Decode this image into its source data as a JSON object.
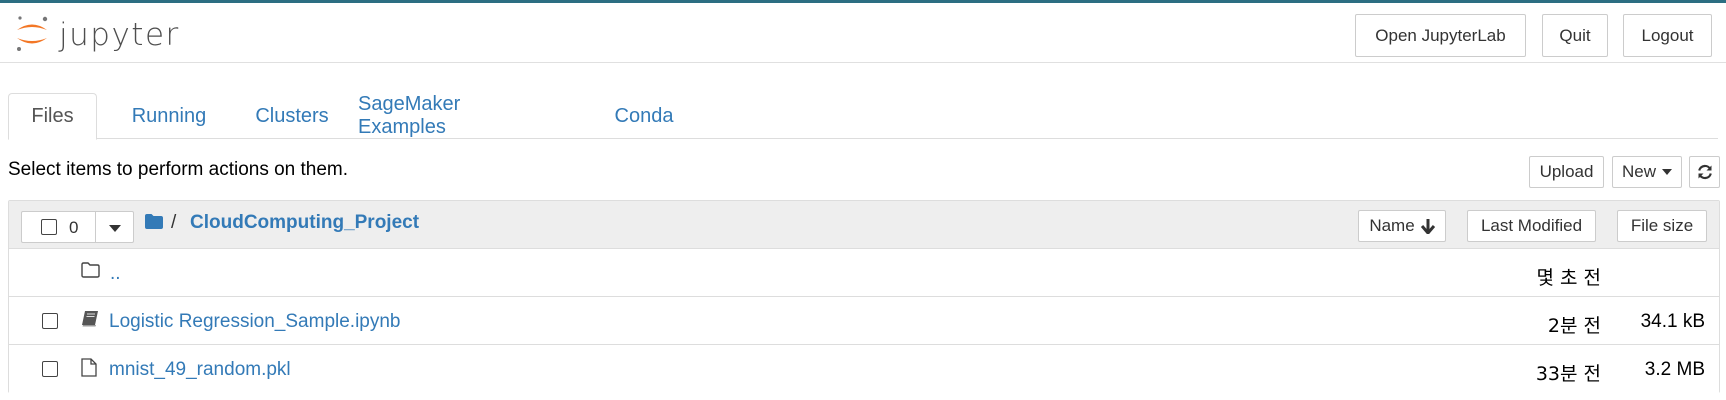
{
  "header": {
    "brand": "jupyter",
    "open_jupyterlab": "Open JupyterLab",
    "quit": "Quit",
    "logout": "Logout"
  },
  "tabs": [
    {
      "label": "Files",
      "active": true
    },
    {
      "label": "Running",
      "active": false
    },
    {
      "label": "Clusters",
      "active": false
    },
    {
      "label": "SageMaker Examples",
      "active": false
    },
    {
      "label": "Conda",
      "active": false
    }
  ],
  "toolbar": {
    "hint": "Select items to perform actions on them.",
    "upload": "Upload",
    "new": "New",
    "refresh_icon": "refresh-icon"
  },
  "list": {
    "selected_count": "0",
    "breadcrumb_sep": "/",
    "breadcrumb_folder": "CloudComputing_Project",
    "sort_name": "Name",
    "sort_modified": "Last Modified",
    "sort_size": "File size",
    "rows": [
      {
        "name": "..",
        "icon": "folder-icon",
        "modified": "몇 초 전",
        "size": ""
      },
      {
        "name": "Logistic Regression_Sample.ipynb",
        "icon": "notebook-icon",
        "modified": "2분 전",
        "size": "34.1 kB"
      },
      {
        "name": "mnist_49_random.pkl",
        "icon": "file-icon",
        "modified": "33분 전",
        "size": "3.2 MB"
      }
    ]
  },
  "colors": {
    "link": "#337ab7",
    "logo_orange": "#f37726",
    "topbar": "#2c6e82"
  }
}
